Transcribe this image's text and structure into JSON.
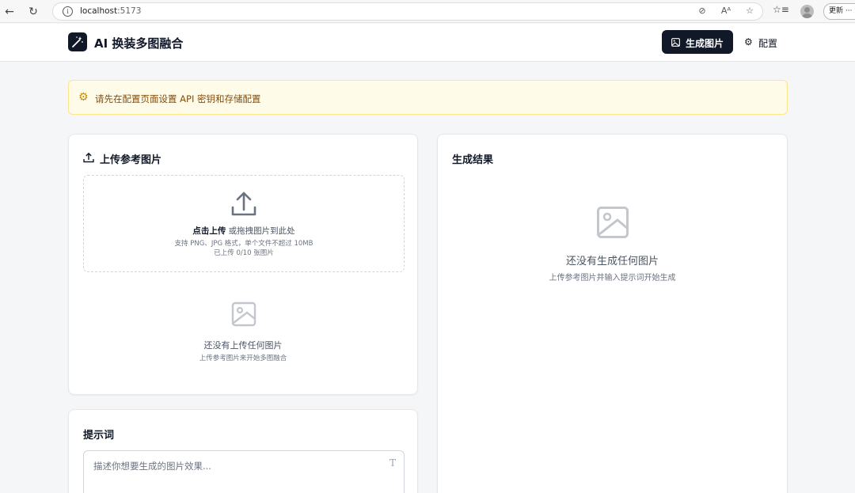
{
  "browser": {
    "url_host": "localhost",
    "url_port": ":5173",
    "update_label": "更新",
    "more_label": "···"
  },
  "header": {
    "app_title": "AI 换装多图融合",
    "generate_label": "生成图片",
    "config_label": "配置"
  },
  "alert": {
    "message": "请先在配置页面设置 API 密钥和存储配置",
    "color": "#fefce8"
  },
  "upload": {
    "title": "上传参考图片",
    "dropzone_bold": "点击上传",
    "dropzone_rest": " 或拖拽图片到此处",
    "formats": "支持 PNG、JPG 格式，单个文件不超过 10MB",
    "count": "已上传 0/10 张图片",
    "empty_title": "还没有上传任何图片",
    "empty_sub": "上传参考图片来开始多图融合"
  },
  "result": {
    "title": "生成结果",
    "empty_title": "还没有生成任何图片",
    "empty_sub": "上传参考图片并输入提示词开始生成"
  },
  "prompt": {
    "title": "提示词",
    "placeholder": "描述你想要生成的图片效果..."
  },
  "colors": {
    "primary": "#111827",
    "alert_border": "#fde68a",
    "alert_text": "#854d0e"
  }
}
